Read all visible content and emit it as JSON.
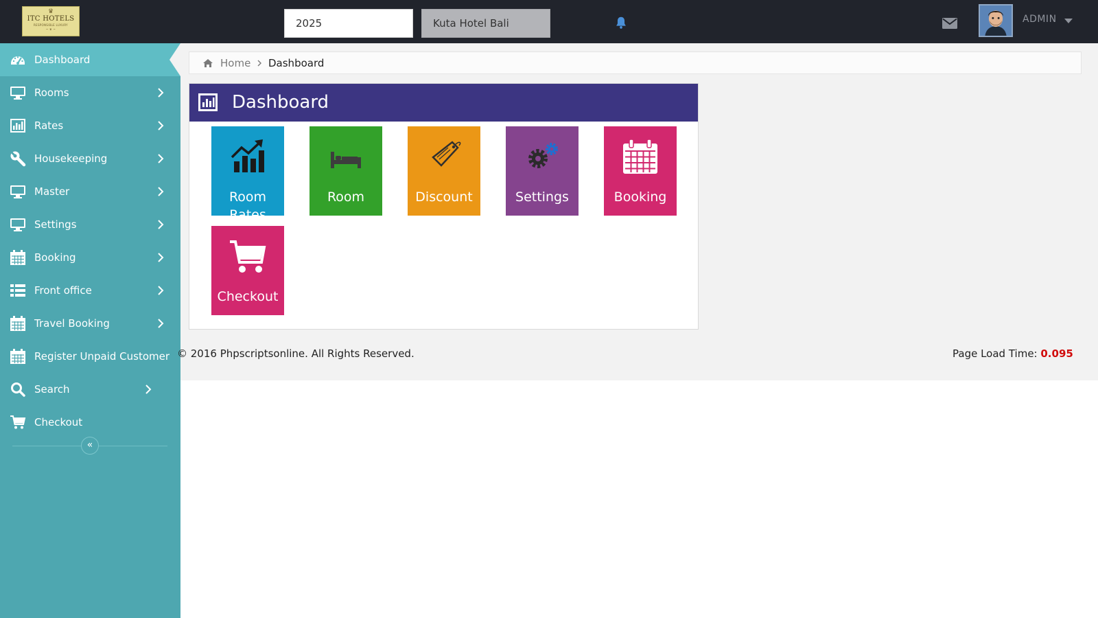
{
  "header": {
    "logo": {
      "crest": "♛",
      "brand": "ITC HOTELS",
      "tagline": "RESPONSIBLE LUXURY",
      "mark": "~ ♛ ~"
    },
    "year_value": "2025",
    "hotel_value": "Kuta Hotel Bali",
    "user_label": "ADMIN",
    "icons": {
      "notifications": "bell-icon",
      "messages": "envelope-icon",
      "user_menu": "caret-down-icon"
    },
    "colors": {
      "bar": "#21242c",
      "bell": "#4a90d9"
    }
  },
  "sidebar": {
    "colors": {
      "background": "#4ea7b0",
      "active": "#5fbdc5"
    },
    "items": [
      {
        "label": "Dashboard",
        "icon": "dashboard-icon",
        "active": true,
        "has_submenu": false
      },
      {
        "label": "Rooms",
        "icon": "monitor-icon",
        "active": false,
        "has_submenu": true
      },
      {
        "label": "Rates",
        "icon": "bar-chart-icon",
        "active": false,
        "has_submenu": true
      },
      {
        "label": "Housekeeping",
        "icon": "wrench-icon",
        "active": false,
        "has_submenu": true
      },
      {
        "label": "Master",
        "icon": "monitor-icon",
        "active": false,
        "has_submenu": true
      },
      {
        "label": "Settings",
        "icon": "monitor-icon",
        "active": false,
        "has_submenu": true
      },
      {
        "label": "Booking",
        "icon": "calendar-icon",
        "active": false,
        "has_submenu": true
      },
      {
        "label": "Front office",
        "icon": "list-icon",
        "active": false,
        "has_submenu": true
      },
      {
        "label": "Travel Booking",
        "icon": "calendar-icon",
        "active": false,
        "has_submenu": true
      },
      {
        "label": "Register Unpaid Customer",
        "icon": "calendar-icon",
        "active": false,
        "has_submenu": false
      },
      {
        "label": "Search",
        "icon": "search-icon",
        "active": false,
        "has_submenu": true
      },
      {
        "label": "Checkout",
        "icon": "cart-icon",
        "active": false,
        "has_submenu": false
      }
    ],
    "collapse_label": "«"
  },
  "breadcrumb": {
    "home": "Home",
    "current": "Dashboard",
    "home_icon": "home-icon"
  },
  "panel": {
    "title": "Dashboard",
    "icon": "bar-chart-icon",
    "header_color": "#3c3582",
    "tiles": [
      {
        "label": "Room Rates",
        "icon": "trending-chart-icon",
        "color": "#139bc9"
      },
      {
        "label": "Room",
        "icon": "bed-icon",
        "color": "#33a12a"
      },
      {
        "label": "Discount",
        "icon": "price-tag-icon",
        "color": "#eb9716"
      },
      {
        "label": "Settings",
        "icon": "gears-icon",
        "color": "#85448e"
      },
      {
        "label": "Booking",
        "icon": "calendar-icon",
        "color": "#d2286e"
      },
      {
        "label": "Checkout",
        "icon": "cart-icon",
        "color": "#d2286e"
      }
    ]
  },
  "footer": {
    "copyright": "© 2016 Phpscriptsonline. All Rights Reserved.",
    "load_time_label": "Page Load Time: ",
    "load_time_value": "0.095",
    "load_time_color": "#d10d0d"
  }
}
